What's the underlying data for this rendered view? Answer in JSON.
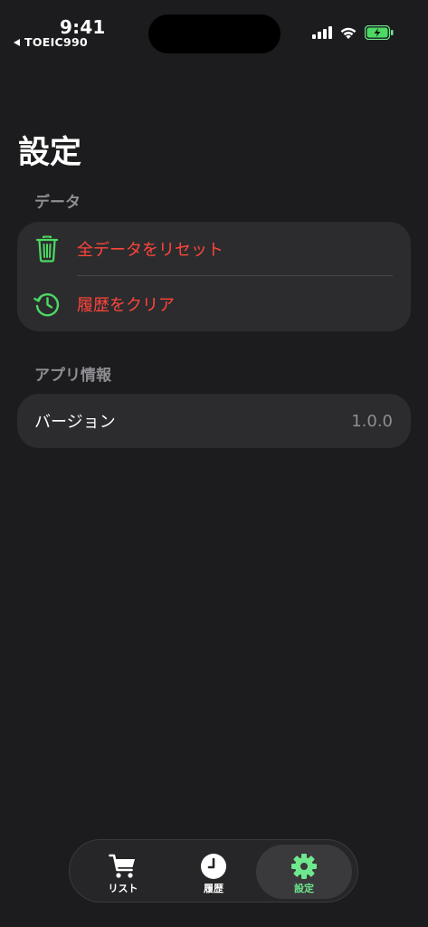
{
  "status_bar": {
    "time": "9:41",
    "back_app": "TOEIC990"
  },
  "title": "設定",
  "sections": {
    "data": {
      "header": "データ",
      "items": [
        {
          "label": "全データをリセット",
          "icon": "trash-icon"
        },
        {
          "label": "履歴をクリア",
          "icon": "history-icon"
        }
      ]
    },
    "app_info": {
      "header": "アプリ情報",
      "version_label": "バージョン",
      "version_value": "1.0.0"
    }
  },
  "tabbar": {
    "tabs": [
      {
        "label": "リスト",
        "icon": "cart-icon",
        "active": false
      },
      {
        "label": "履歴",
        "icon": "clock-icon",
        "active": false
      },
      {
        "label": "設定",
        "icon": "gear-icon",
        "active": true
      }
    ]
  },
  "colors": {
    "background": "#1c1c1e",
    "card": "#2c2c2e",
    "destructive": "#ff453a",
    "accent_green": "#6ee78d",
    "secondary_text": "#8e8e93"
  }
}
